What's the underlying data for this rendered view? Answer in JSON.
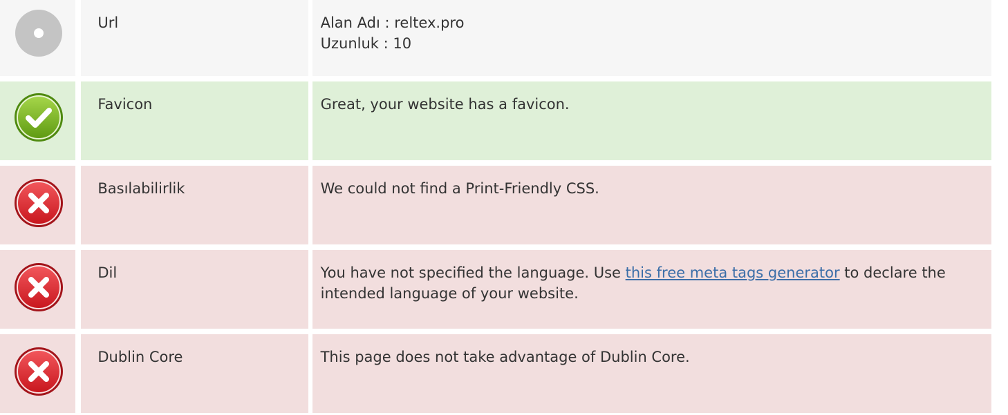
{
  "rows": [
    {
      "status": "neutral",
      "icon": "neutral-dot-icon",
      "label": "Url",
      "lines": [
        "Alan Adı : reltex.pro",
        "Uzunluk : 10"
      ]
    },
    {
      "status": "pass",
      "icon": "checkmark-icon",
      "label": "Favicon",
      "text": "Great, your website has a favicon."
    },
    {
      "status": "fail",
      "icon": "error-x-icon",
      "label": "Basılabilirlik",
      "text": "We could not find a Print-Friendly CSS."
    },
    {
      "status": "fail",
      "icon": "error-x-icon",
      "label": "Dil",
      "text_before": "You have not specified the language. Use ",
      "link_text": "this free meta tags generator",
      "text_after": " to declare the intended language of your website."
    },
    {
      "status": "fail",
      "icon": "error-x-icon",
      "label": "Dublin Core",
      "text": "This page does not take advantage of Dublin Core."
    }
  ],
  "colors": {
    "neutral_bg": "#f6f6f6",
    "pass_bg": "#dff0d8",
    "fail_bg": "#f2dede",
    "link": "#3b6ea8",
    "pass_icon": "#7ab51d",
    "fail_icon": "#e0323a",
    "neutral_icon": "#c4c4c4"
  }
}
